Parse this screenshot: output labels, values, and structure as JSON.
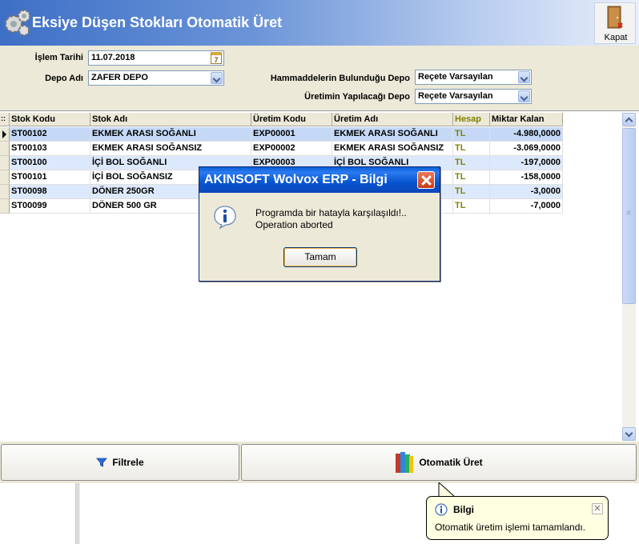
{
  "header": {
    "title": "Eksiye Düşen Stokları Otomatik Üret",
    "close_label": "Kapat"
  },
  "form": {
    "islem_tarihi_label": "İşlem Tarihi",
    "islem_tarihi_value": "11.07.2018",
    "depo_adi_label": "Depo Adı",
    "depo_adi_value": "ZAFER DEPO",
    "hammadde_label": "Hammaddelerin Bulunduğu Depo",
    "hammadde_value": "Reçete Varsayılan",
    "uretim_label": "Üretimin Yapılacağı Depo",
    "uretim_value": "Reçete Varsayılan",
    "calendar_icon_text": "7"
  },
  "grid": {
    "headers": [
      "Stok Kodu",
      "Stok Adı",
      "Üretim Kodu",
      "Üretim Adı",
      "Hesap",
      "Miktar Kalan"
    ],
    "rows": [
      {
        "stok_kodu": "ST00102",
        "stok_adi": "EKMEK ARASI SOĞANLI",
        "uretim_kodu": "EXP00001",
        "uretim_adi": "EKMEK ARASI SOĞANLI",
        "hesap": "TL",
        "miktar": "-4.980,0000"
      },
      {
        "stok_kodu": "ST00103",
        "stok_adi": "EKMEK ARASI SOĞANSIZ",
        "uretim_kodu": "EXP00002",
        "uretim_adi": "EKMEK ARASI SOĞANSIZ",
        "hesap": "TL",
        "miktar": "-3.069,0000"
      },
      {
        "stok_kodu": "ST00100",
        "stok_adi": "İÇİ BOL SOĞANLI",
        "uretim_kodu": "EXP00003",
        "uretim_adi": "İÇİ BOL SOĞANLI",
        "hesap": "TL",
        "miktar": "-197,0000"
      },
      {
        "stok_kodu": "ST00101",
        "stok_adi": "İÇİ BOL SOĞANSIZ",
        "uretim_kodu": "",
        "uretim_adi": "",
        "hesap": "TL",
        "miktar": "-158,0000"
      },
      {
        "stok_kodu": "ST00098",
        "stok_adi": "DÖNER 250GR",
        "uretim_kodu": "",
        "uretim_adi": "",
        "hesap": "TL",
        "miktar": "-3,0000"
      },
      {
        "stok_kodu": "ST00099",
        "stok_adi": "DÖNER 500 GR",
        "uretim_kodu": "",
        "uretim_adi": "",
        "hesap": "TL",
        "miktar": "-7,0000"
      }
    ]
  },
  "buttons": {
    "filtrele": "Filtrele",
    "otomatik_uret": "Otomatik Üret"
  },
  "dialog": {
    "title": "AKINSOFT Wolvox ERP - Bilgi",
    "message_line1": "Programda bir hatayla karşılaşıldı!..",
    "message_line2": "Operation aborted",
    "ok_label": "Tamam"
  },
  "balloon": {
    "title": "Bilgi",
    "text": "Otomatik üretim işlemi tamamlandı.",
    "close": "✕"
  },
  "colors": {
    "header_blue": "#3d6fc6",
    "dialog_title_blue": "#0a5ed9",
    "row_alt": "#dce9fc",
    "row_selected": "#c5d9f7",
    "hesap_color": "#808000",
    "balloon_bg": "#ffffe1"
  }
}
